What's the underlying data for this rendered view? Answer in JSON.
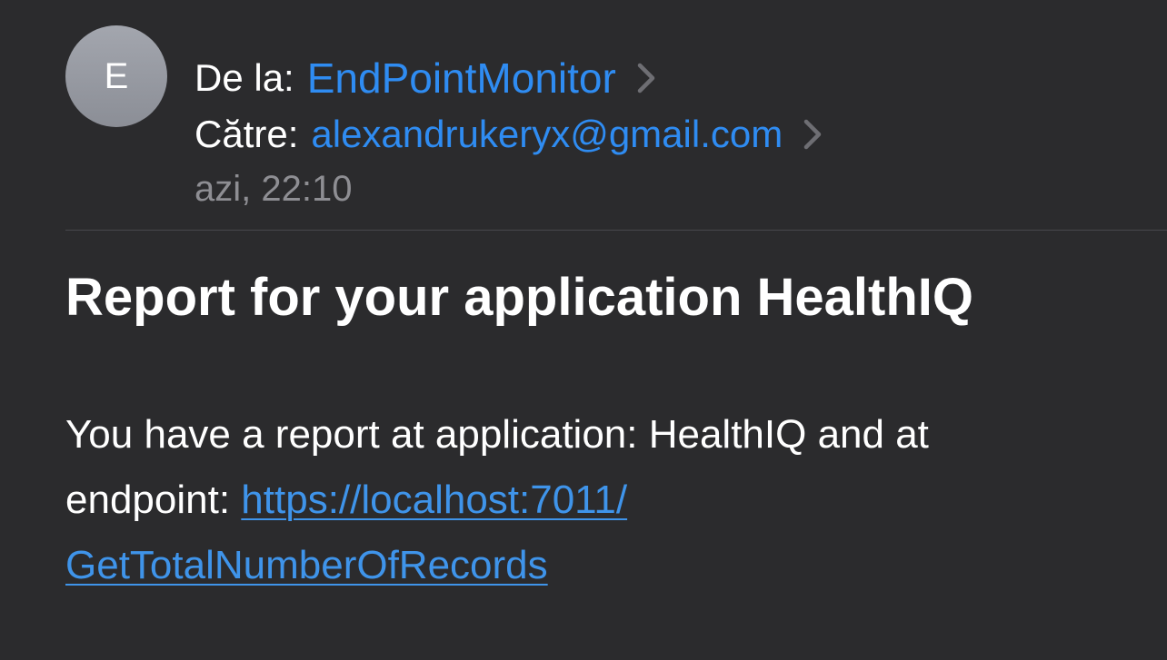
{
  "header": {
    "avatar_initial": "E",
    "from_label": "De la:",
    "sender": "EndPointMonitor",
    "to_label": "Către:",
    "recipient": "alexandrukeryx@gmail.com",
    "timestamp": "azi, 22:10"
  },
  "email": {
    "subject": "Report for your application HealthIQ",
    "body_text": "You have a report at application: HealthIQ and at endpoint:",
    "link_line1": "https://localhost:7011/",
    "link_line2": "GetTotalNumberOfRecords"
  },
  "icons": {
    "chevron": "chevron-right-icon"
  },
  "colors": {
    "background": "#2b2b2d",
    "accent": "#2f8cf2",
    "link": "#3f94ea",
    "secondary_text": "#8e8e93",
    "avatar": "#9a9da5"
  }
}
